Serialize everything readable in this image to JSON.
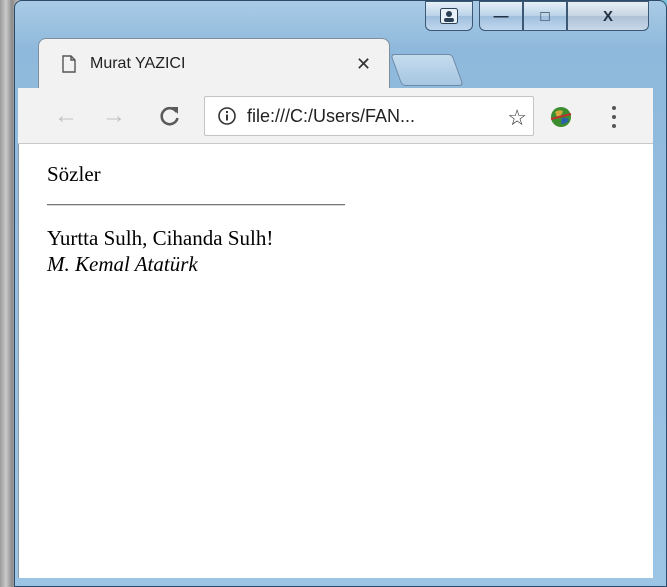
{
  "browser": {
    "tab": {
      "title": "Murat YAZICI"
    },
    "window_controls": {
      "minimize": "—",
      "maximize": "□",
      "close": "X"
    },
    "address": {
      "url": "file:///C:/Users/FAN..."
    }
  },
  "page": {
    "heading": "Sözler",
    "quote": "Yurtta Sulh, Cihanda Sulh!",
    "author": "M. Kemal Atatürk"
  }
}
